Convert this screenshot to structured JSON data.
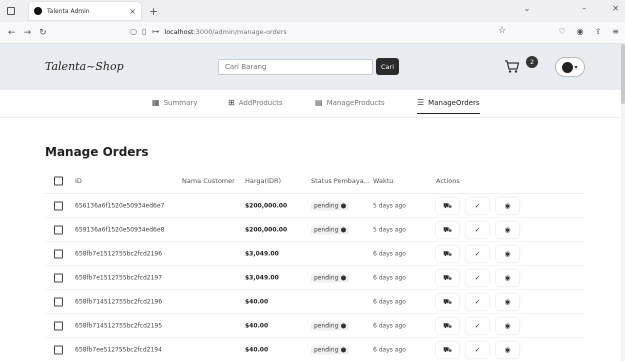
{
  "browser": {
    "tab_title": "Talenta Admin",
    "tab_close": "×",
    "new_tab": "+",
    "url_prefix": "",
    "url_host": "localhost",
    "url_path": ":3000/admin/manage-orders"
  },
  "header": {
    "brand": "Talenta~Shop",
    "search_placeholder": "Cari Barang",
    "search_button": "Cari",
    "cart_count": "2"
  },
  "subnav": {
    "summary": "Summary",
    "add_products": "AddProducts",
    "manage_products": "ManageProducts",
    "manage_orders": "ManageOrders"
  },
  "page": {
    "title": "Manage Orders"
  },
  "table": {
    "headers": {
      "id": "ID",
      "name": "Nama Customer",
      "harga": "Harga(IDR)",
      "status": "Status Pembaya...",
      "waktu": "Waktu",
      "actions": "Actions"
    },
    "rows": [
      {
        "id": "656136a6f1520e50934ed6e7",
        "name": "",
        "harga": "$200,000.00",
        "status": "pending",
        "waktu": "5 days ago"
      },
      {
        "id": "659136a6f1520e50934ed6e8",
        "name": "",
        "harga": "$200,000.00",
        "status": "pending",
        "waktu": "5 days ago"
      },
      {
        "id": "658fb7e1512755bc2fcd2196",
        "name": "",
        "harga": "$3,049.00",
        "status": "",
        "waktu": "6 days ago"
      },
      {
        "id": "658fb7e1512755bc2fcd2197",
        "name": "",
        "harga": "$3,049.00",
        "status": "pending",
        "waktu": "6 days ago"
      },
      {
        "id": "658fb714512755bc2fcd2196",
        "name": "",
        "harga": "$40.00",
        "status": "",
        "waktu": "6 days ago"
      },
      {
        "id": "658fb714512755bc2fcd2195",
        "name": "",
        "harga": "$40.00",
        "status": "pending",
        "waktu": "6 days ago"
      },
      {
        "id": "658fb7ee512755bc2fcd2194",
        "name": "",
        "harga": "$40.00",
        "status": "pending",
        "waktu": "6 days ago"
      }
    ],
    "action_icons": [
      "truck-icon",
      "check-icon",
      "eye-icon"
    ]
  }
}
